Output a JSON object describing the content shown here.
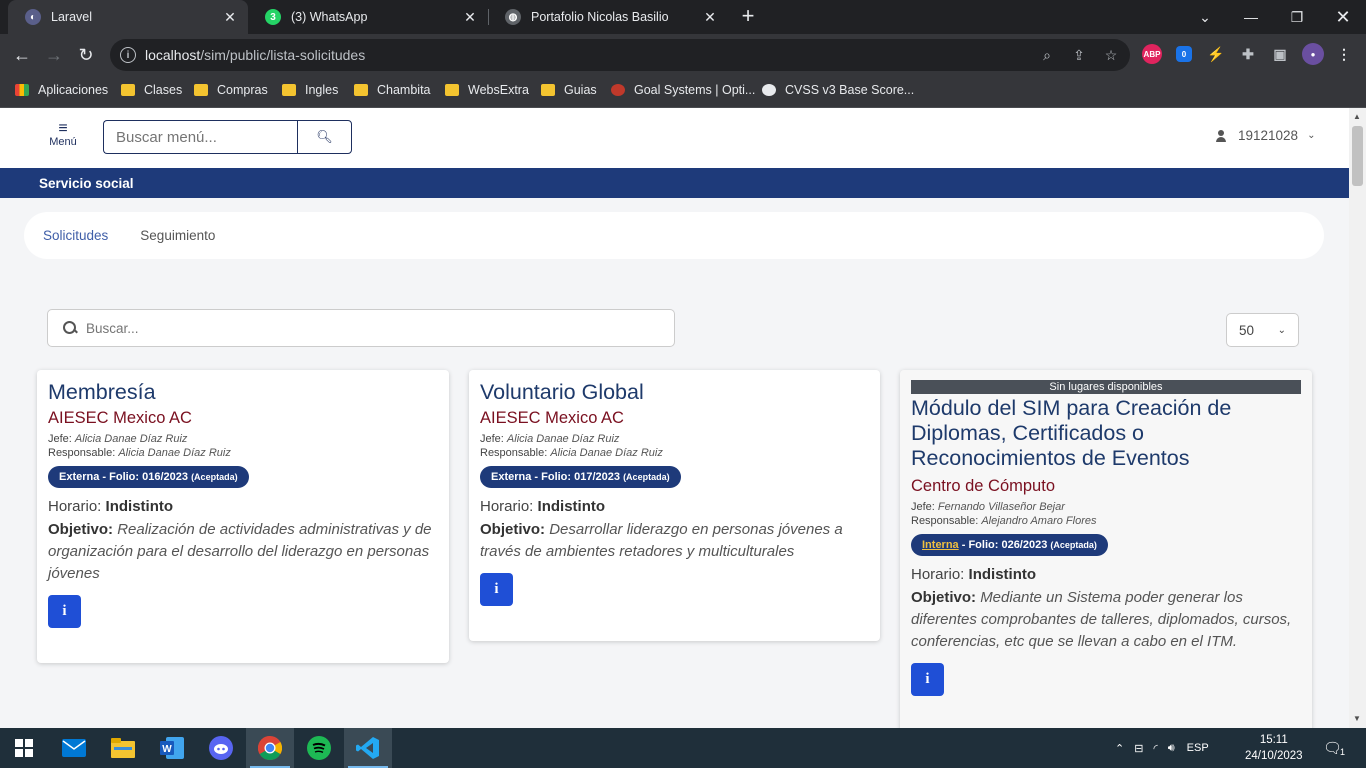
{
  "browser": {
    "tabs": [
      {
        "title": "Laravel",
        "favicon_color": "#5a5f8a",
        "favicon_glyph": "◐"
      },
      {
        "title": "(3) WhatsApp",
        "favicon_color": "#25d366",
        "favicon_glyph": "3"
      },
      {
        "title": "Portafolio Nicolas Basilio",
        "favicon_color": "#5f6368",
        "favicon_glyph": "◍"
      }
    ],
    "url_host": "localhost",
    "url_path": "/sim/public/lista-solicitudes",
    "bookmarks": [
      {
        "label": "Aplicaciones",
        "icon": "apps-grid-icon"
      },
      {
        "label": "Clases",
        "icon": "folder-icon"
      },
      {
        "label": "Compras",
        "icon": "folder-icon"
      },
      {
        "label": "Ingles",
        "icon": "folder-icon"
      },
      {
        "label": "Chambita",
        "icon": "folder-icon"
      },
      {
        "label": "WebsExtra",
        "icon": "folder-icon"
      },
      {
        "label": "Guias",
        "icon": "folder-icon"
      },
      {
        "label": "Goal Systems | Opti...",
        "icon": "goal-logo-icon"
      },
      {
        "label": "CVSS v3 Base Score...",
        "icon": "globe-icon"
      }
    ],
    "ext_badge": "0",
    "abp_label": "ABP"
  },
  "header": {
    "menu_label": "Menú",
    "search_placeholder": "Buscar menú...",
    "user_id": "19121028"
  },
  "section_title": "Servicio social",
  "nav_tabs": [
    "Solicitudes",
    "Seguimiento"
  ],
  "list_search_placeholder": "Buscar...",
  "per_page": "50",
  "cards": [
    {
      "title": "Membresía",
      "org": "AIESEC Mexico AC",
      "jefe_label": "Jefe:",
      "jefe": "Alicia Danae Díaz Ruiz",
      "resp_label": "Responsable:",
      "resp": "Alicia Danae Díaz Ruiz",
      "badge_type": "Externa",
      "badge_folio": " - Folio: 016/2023 ",
      "badge_status": "(Aceptada)",
      "horario_label": "Horario:",
      "horario": "Indistinto",
      "objetivo_label": "Objetivo:",
      "objetivo": "Realización de actividades administrativas y de organización para el desarrollo del liderazgo en personas jóvenes",
      "info_label": "i"
    },
    {
      "title": "Voluntario Global",
      "org": "AIESEC Mexico AC",
      "jefe_label": "Jefe:",
      "jefe": "Alicia Danae Díaz Ruiz",
      "resp_label": "Responsable:",
      "resp": "Alicia Danae Díaz Ruiz",
      "badge_type": "Externa",
      "badge_folio": " - Folio: 017/2023 ",
      "badge_status": "(Aceptada)",
      "horario_label": "Horario:",
      "horario": "Indistinto",
      "objetivo_label": "Objetivo:",
      "objetivo": "Desarrollar liderazgo en personas jóvenes a través de ambientes retadores y multiculturales",
      "info_label": "i"
    },
    {
      "notice": "Sin lugares disponibles",
      "title": "Módulo del SIM para Creación de Diplomas, Certificados o Reconocimientos de Eventos",
      "org": "Centro de Cómputo",
      "jefe_label": "Jefe:",
      "jefe": "Fernando Villaseñor Bejar",
      "resp_label": "Responsable:",
      "resp": "Alejandro Amaro Flores",
      "badge_type": "Interna",
      "badge_folio": " - Folio: 026/2023 ",
      "badge_status": "(Aceptada)",
      "horario_label": "Horario:",
      "horario": "Indistinto",
      "objetivo_label": "Objetivo:",
      "objetivo": "Mediante un Sistema poder generar los diferentes comprobantes de talleres, diplomados, cursos, conferencias, etc que se llevan a cabo en el ITM.",
      "info_label": "i"
    }
  ],
  "taskbar": {
    "apps": [
      "start-icon",
      "mail-icon",
      "file-explorer-icon",
      "word-icon",
      "discord-icon",
      "chrome-icon",
      "spotify-icon",
      "vscode-icon"
    ],
    "language": "ESP",
    "time": "15:11",
    "date": "24/10/2023",
    "notifications": "1"
  },
  "colors": {
    "brand_blue": "#1e3a7a",
    "org_red": "#7a1020",
    "info_button": "#1f4fd6"
  }
}
